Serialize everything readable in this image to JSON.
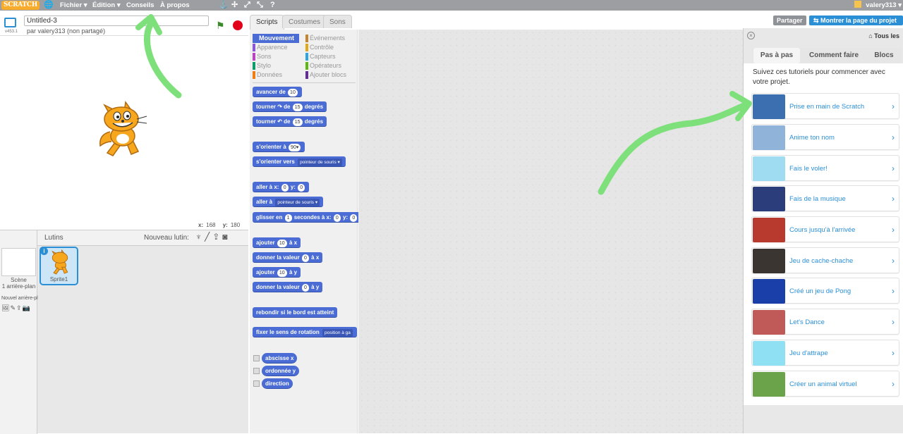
{
  "topbar": {
    "logo": "SCRATCH",
    "menus": [
      "Fichier ▾",
      "Édition ▾",
      "Conseils",
      "À propos"
    ],
    "user": "valery313 ▾"
  },
  "project": {
    "title": "Untitled-3",
    "byline": "par valery313 (non partagé)",
    "version": "v453.1"
  },
  "stage": {
    "x_label": "x:",
    "x_value": "168",
    "y_label": "y:",
    "y_value": "180"
  },
  "sprites": {
    "header": "Lutins",
    "new_sprite": "Nouveau lutin:",
    "scene_label": "Scène",
    "scene_sub": "1 arrière-plan",
    "new_backdrop": "Nouvel arrière-pl",
    "sprite_name": "Sprite1",
    "info": "i"
  },
  "editor_tabs": [
    "Scripts",
    "Costumes",
    "Sons"
  ],
  "categories": [
    {
      "label": "Mouvement",
      "color": "#4a6cd4"
    },
    {
      "label": "Événements",
      "color": "#c88330"
    },
    {
      "label": "Apparence",
      "color": "#8a55d7"
    },
    {
      "label": "Contrôle",
      "color": "#e1a91a"
    },
    {
      "label": "Sons",
      "color": "#bb42c3"
    },
    {
      "label": "Capteurs",
      "color": "#2ca5e2"
    },
    {
      "label": "Stylo",
      "color": "#0e9a6c"
    },
    {
      "label": "Opérateurs",
      "color": "#5cb712"
    },
    {
      "label": "Données",
      "color": "#ee7d16"
    },
    {
      "label": "Ajouter blocs",
      "color": "#632d99"
    }
  ],
  "blocks": {
    "move": {
      "pre": "avancer de",
      "n": "10"
    },
    "turn_right": {
      "pre": "tourner",
      "mid": "de",
      "n": "15",
      "post": "degrés"
    },
    "turn_left": {
      "pre": "tourner",
      "mid": "de",
      "n": "15",
      "post": "degrés"
    },
    "point_dir": {
      "pre": "s'orienter à",
      "n": "90▾"
    },
    "point_to": {
      "pre": "s'orienter vers",
      "dd": "pointeur de souris ▾"
    },
    "goto_xy": {
      "pre": "aller à x:",
      "x": "0",
      "mid": "y:",
      "y": "0"
    },
    "goto": {
      "pre": "aller à",
      "dd": "pointeur de souris ▾"
    },
    "glide": {
      "pre": "glisser en",
      "n": "1",
      "mid": "secondes à x:",
      "x": "0",
      "mid2": "y:",
      "y": "0"
    },
    "change_x": {
      "pre": "ajouter",
      "n": "10",
      "post": "à x"
    },
    "set_x": {
      "pre": "donner la valeur",
      "n": "0",
      "post": "à x"
    },
    "change_y": {
      "pre": "ajouter",
      "n": "10",
      "post": "à y"
    },
    "set_y": {
      "pre": "donner la valeur",
      "n": "0",
      "post": "à y"
    },
    "bounce": "rebondir si le bord est atteint",
    "rot_style": {
      "pre": "fixer le sens de rotation",
      "dd": "position à ga"
    },
    "reporters": [
      "abscisse x",
      "ordonnée y",
      "direction"
    ]
  },
  "right_panel": {
    "share": "Partager",
    "see_page": "Montrer la page du projet",
    "all_label": "Tous les",
    "tabs": [
      "Pas à pas",
      "Comment faire",
      "Blocs"
    ],
    "intro": "Suivez ces tutoriels pour commencer avec votre projet.",
    "tutorials": [
      {
        "label": "Prise en main de Scratch",
        "thumb": "#3b6fb0"
      },
      {
        "label": "Anime ton nom",
        "thumb": "#8fb3d9"
      },
      {
        "label": "Fais le voler!",
        "thumb": "#9fdcf2"
      },
      {
        "label": "Fais de la musique",
        "thumb": "#2b3d7a"
      },
      {
        "label": "Cours jusqu'à l'arrivée",
        "thumb": "#b83a2e"
      },
      {
        "label": "Jeu de cache-chache",
        "thumb": "#3a3530"
      },
      {
        "label": "Créé un jeu de Pong",
        "thumb": "#1b3fa8"
      },
      {
        "label": "Let's Dance",
        "thumb": "#c05a58"
      },
      {
        "label": "Jeu d'attrape",
        "thumb": "#8fe0f2"
      },
      {
        "label": "Créer un animal virtuel",
        "thumb": "#6ba34a"
      }
    ],
    "arrow_glyph": "›"
  }
}
